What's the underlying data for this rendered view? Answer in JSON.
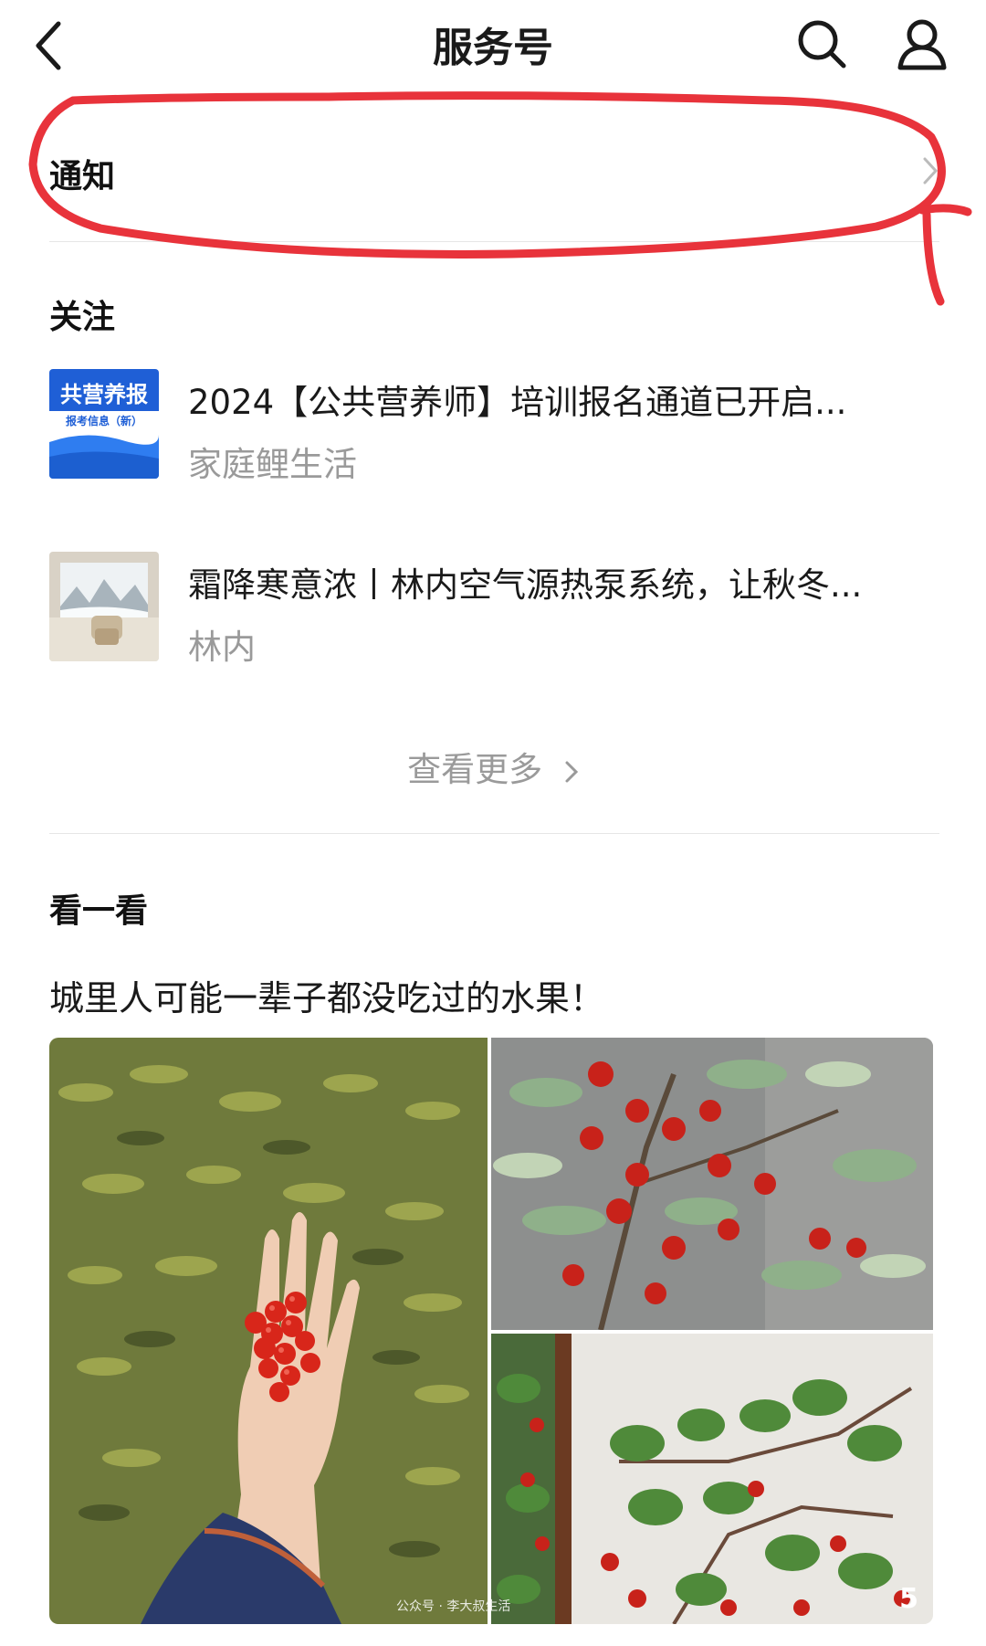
{
  "header": {
    "title": "服务号",
    "back_icon": "chevron-left-icon",
    "search_icon": "search-icon",
    "user_icon": "user-icon"
  },
  "notification": {
    "label": "通知"
  },
  "following": {
    "section_title": "关注",
    "items": [
      {
        "title": "2024【公共营养师】培训报名通道已开启...",
        "source": "家庭鲤生活",
        "thumb_text_main": "共营养报",
        "thumb_text_sub": "报考信息（新）"
      },
      {
        "title": "霜降寒意浓丨林内空气源热泵系统，让秋冬...",
        "source": "林内"
      }
    ],
    "more_label": "查看更多"
  },
  "look": {
    "section_title": "看一看",
    "article_title": "城里人可能一辈子都没吃过的水果！",
    "watermark": "公众号 · 李大叔生活",
    "image_count": "5"
  },
  "colors": {
    "annotation_red": "#e8333b",
    "accent_blue": "#1a73e8"
  }
}
